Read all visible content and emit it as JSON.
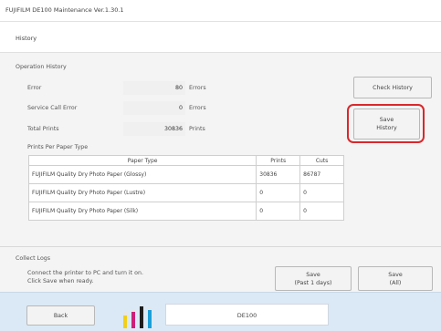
{
  "window": {
    "title": "FUJIFILM DE100 Maintenance Ver.1.30.1"
  },
  "header": {
    "breadcrumb": "History"
  },
  "operation_history": {
    "section_label": "Operation History",
    "rows": [
      {
        "label": "Error",
        "value": "80",
        "unit": "Errors"
      },
      {
        "label": "Service Call Error",
        "value": "0",
        "unit": "Errors"
      },
      {
        "label": "Total Prints",
        "value": "30836",
        "unit": "Prints"
      }
    ],
    "check_history_label": "Check History",
    "save_history_label_line1": "Save",
    "save_history_label_line2": "History"
  },
  "paper_table": {
    "section_label": "Prints Per Paper Type",
    "columns": [
      "Paper Type",
      "Prints",
      "Cuts"
    ],
    "rows": [
      [
        "FUJIFILM Quality Dry Photo Paper (Glossy)",
        "30836",
        "86787"
      ],
      [
        "FUJIFILM Quality Dry Photo Paper (Lustre)",
        "0",
        "0"
      ],
      [
        "FUJIFILM Quality Dry Photo Paper (Silk)",
        "0",
        "0"
      ]
    ]
  },
  "collect_logs": {
    "section_label": "Collect Logs",
    "instruction_line1": "Connect the printer to PC and turn it on.",
    "instruction_line2": "Click Save when ready.",
    "save_past_line1": "Save",
    "save_past_line2": "(Past 1 days)",
    "save_all_line1": "Save",
    "save_all_line2": "(All)"
  },
  "footer": {
    "back_label": "Back",
    "status_text": "DE100",
    "ink_colors": [
      "#f2cf18",
      "#cc1f7a",
      "#1d1d1d",
      "#1b9fd8"
    ]
  },
  "colors": {
    "highlight": "#d9282c",
    "footer_bg": "#dbe9f6"
  }
}
